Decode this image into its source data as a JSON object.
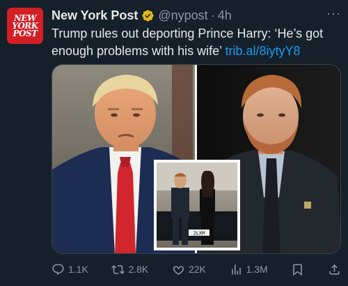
{
  "tweet": {
    "avatar_text": [
      "NEW",
      "YORK",
      "POST"
    ],
    "display_name": "New York Post",
    "handle": "@nypost",
    "separator": "·",
    "time": "4h",
    "more_label": "···",
    "text": "Trump rules out deporting Prince Harry: ‘He’s got enough problems with his wife’",
    "link": "trib.al/8iytyY8",
    "media": {
      "inset_plate": "2LXM"
    },
    "actions": {
      "replies": "1.1K",
      "retweets": "2.8K",
      "likes": "22K",
      "views": "1.3M"
    }
  },
  "colors": {
    "background": "#15202b",
    "text_primary": "#e7e9ea",
    "text_secondary": "#8b98a5",
    "link": "#1d9bf0",
    "brand_red": "#d21f26",
    "verified_gold": "#e2b719"
  },
  "icons": [
    "verified-badge-icon",
    "more-icon",
    "reply-icon",
    "retweet-icon",
    "like-icon",
    "views-icon",
    "bookmark-icon",
    "share-icon"
  ]
}
